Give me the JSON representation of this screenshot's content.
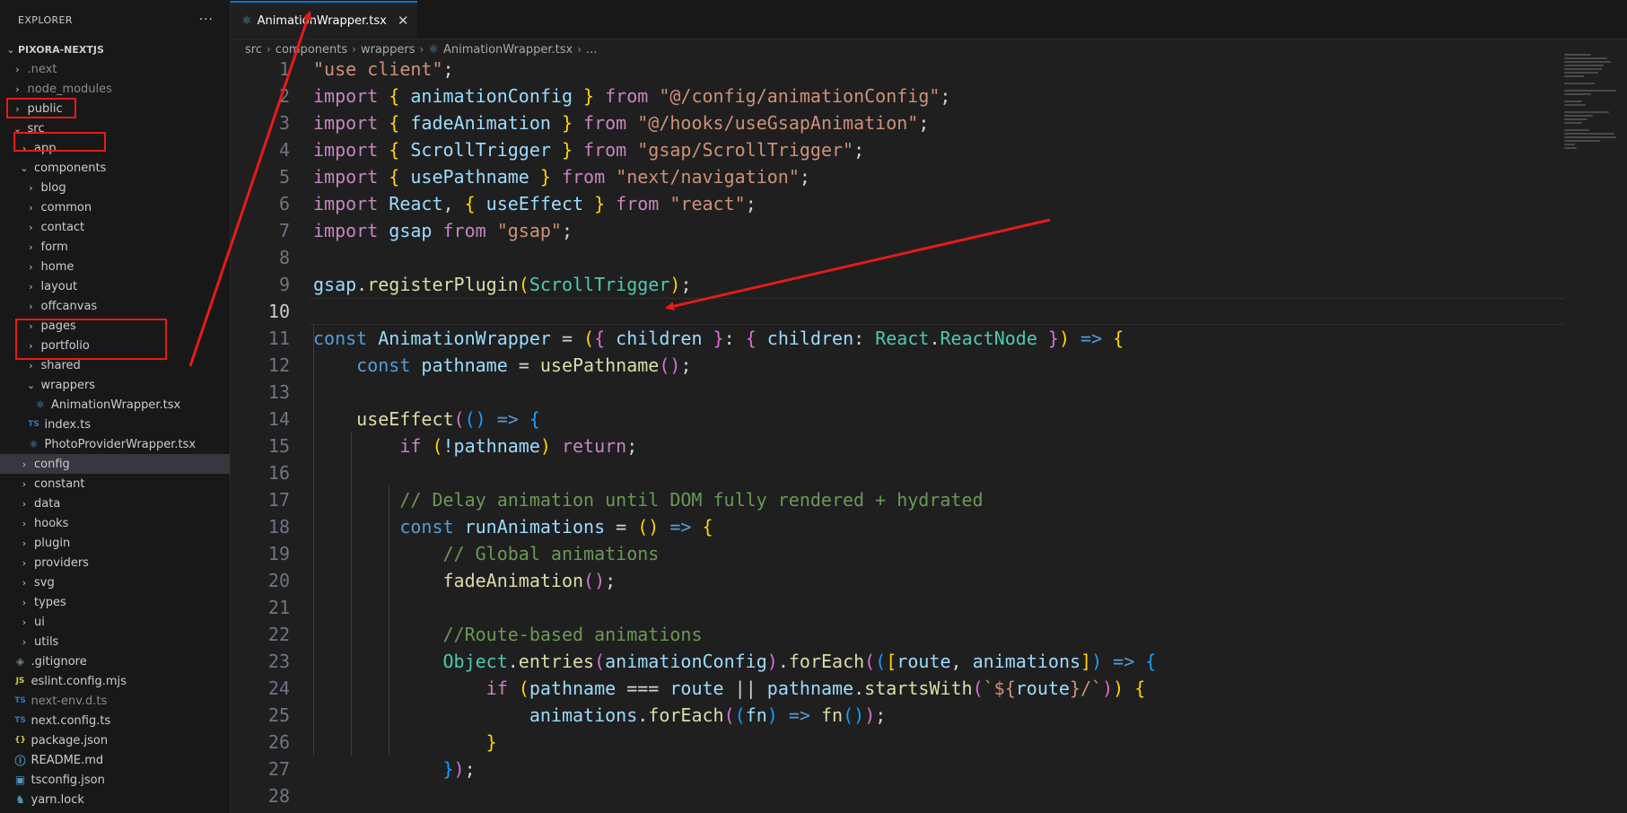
{
  "explorer": {
    "title": "EXPLORER",
    "more": "···",
    "root": "PIXORA-NEXTJS",
    "items": [
      {
        "label": ".next",
        "depth": 1,
        "kind": "folder",
        "open": false,
        "dim": true
      },
      {
        "label": "node_modules",
        "depth": 1,
        "kind": "folder",
        "open": false,
        "dim": true
      },
      {
        "label": "public",
        "depth": 1,
        "kind": "folder",
        "open": false
      },
      {
        "label": "src",
        "depth": 1,
        "kind": "folder",
        "open": true
      },
      {
        "label": "app",
        "depth": 2,
        "kind": "folder",
        "open": false
      },
      {
        "label": "components",
        "depth": 2,
        "kind": "folder",
        "open": true
      },
      {
        "label": "blog",
        "depth": 3,
        "kind": "folder",
        "open": false
      },
      {
        "label": "common",
        "depth": 3,
        "kind": "folder",
        "open": false
      },
      {
        "label": "contact",
        "depth": 3,
        "kind": "folder",
        "open": false
      },
      {
        "label": "form",
        "depth": 3,
        "kind": "folder",
        "open": false
      },
      {
        "label": "home",
        "depth": 3,
        "kind": "folder",
        "open": false
      },
      {
        "label": "layout",
        "depth": 3,
        "kind": "folder",
        "open": false
      },
      {
        "label": "offcanvas",
        "depth": 3,
        "kind": "folder",
        "open": false
      },
      {
        "label": "pages",
        "depth": 3,
        "kind": "folder",
        "open": false
      },
      {
        "label": "portfolio",
        "depth": 3,
        "kind": "folder",
        "open": false
      },
      {
        "label": "shared",
        "depth": 3,
        "kind": "folder",
        "open": false
      },
      {
        "label": "wrappers",
        "depth": 3,
        "kind": "folder",
        "open": true
      },
      {
        "label": "AnimationWrapper.tsx",
        "depth": 4,
        "kind": "react-file"
      },
      {
        "label": "index.ts",
        "depth": 3,
        "kind": "ts-file"
      },
      {
        "label": "PhotoProviderWrapper.tsx",
        "depth": 3,
        "kind": "react-file"
      },
      {
        "label": "config",
        "depth": 2,
        "kind": "folder",
        "open": false,
        "selected": true
      },
      {
        "label": "constant",
        "depth": 2,
        "kind": "folder",
        "open": false
      },
      {
        "label": "data",
        "depth": 2,
        "kind": "folder",
        "open": false
      },
      {
        "label": "hooks",
        "depth": 2,
        "kind": "folder",
        "open": false
      },
      {
        "label": "plugin",
        "depth": 2,
        "kind": "folder",
        "open": false
      },
      {
        "label": "providers",
        "depth": 2,
        "kind": "folder",
        "open": false
      },
      {
        "label": "svg",
        "depth": 2,
        "kind": "folder",
        "open": false
      },
      {
        "label": "types",
        "depth": 2,
        "kind": "folder",
        "open": false
      },
      {
        "label": "ui",
        "depth": 2,
        "kind": "folder",
        "open": false
      },
      {
        "label": "utils",
        "depth": 2,
        "kind": "folder",
        "open": false
      },
      {
        "label": ".gitignore",
        "depth": 1,
        "kind": "git-file"
      },
      {
        "label": "eslint.config.mjs",
        "depth": 1,
        "kind": "js-file"
      },
      {
        "label": "next-env.d.ts",
        "depth": 1,
        "kind": "ts-file",
        "dim": true
      },
      {
        "label": "next.config.ts",
        "depth": 1,
        "kind": "ts-file"
      },
      {
        "label": "package.json",
        "depth": 1,
        "kind": "json-file"
      },
      {
        "label": "README.md",
        "depth": 1,
        "kind": "info-file"
      },
      {
        "label": "tsconfig.json",
        "depth": 1,
        "kind": "tsconfig-file"
      },
      {
        "label": "yarn.lock",
        "depth": 1,
        "kind": "yarn-file"
      }
    ]
  },
  "tab": {
    "label": "AnimationWrapper.tsx",
    "close": "✕"
  },
  "breadcrumb": [
    "src",
    "components",
    "wrappers",
    "AnimationWrapper.tsx",
    "..."
  ],
  "code": {
    "current_line": 10,
    "lines": [
      [
        [
          "\"use client\"",
          "str"
        ],
        [
          ";",
          "pl"
        ]
      ],
      [
        [
          "import",
          "kw"
        ],
        [
          " ",
          "pl"
        ],
        [
          "{",
          "b1"
        ],
        [
          " animationConfig ",
          "var"
        ],
        [
          "}",
          "b1"
        ],
        [
          " from ",
          "kw"
        ],
        [
          "\"@/config/animationConfig\"",
          "str"
        ],
        [
          ";",
          "pl"
        ]
      ],
      [
        [
          "import",
          "kw"
        ],
        [
          " ",
          "pl"
        ],
        [
          "{",
          "b1"
        ],
        [
          " fadeAnimation ",
          "var"
        ],
        [
          "}",
          "b1"
        ],
        [
          " from ",
          "kw"
        ],
        [
          "\"@/hooks/useGsapAnimation\"",
          "str"
        ],
        [
          ";",
          "pl"
        ]
      ],
      [
        [
          "import",
          "kw"
        ],
        [
          " ",
          "pl"
        ],
        [
          "{",
          "b1"
        ],
        [
          " ScrollTrigger ",
          "var"
        ],
        [
          "}",
          "b1"
        ],
        [
          " from ",
          "kw"
        ],
        [
          "\"gsap/ScrollTrigger\"",
          "str"
        ],
        [
          ";",
          "pl"
        ]
      ],
      [
        [
          "import",
          "kw"
        ],
        [
          " ",
          "pl"
        ],
        [
          "{",
          "b1"
        ],
        [
          " usePathname ",
          "var"
        ],
        [
          "}",
          "b1"
        ],
        [
          " from ",
          "kw"
        ],
        [
          "\"next/navigation\"",
          "str"
        ],
        [
          ";",
          "pl"
        ]
      ],
      [
        [
          "import",
          "kw"
        ],
        [
          " React",
          "var"
        ],
        [
          ", ",
          "pl"
        ],
        [
          "{",
          "b1"
        ],
        [
          " useEffect ",
          "var"
        ],
        [
          "}",
          "b1"
        ],
        [
          " from ",
          "kw"
        ],
        [
          "\"react\"",
          "str"
        ],
        [
          ";",
          "pl"
        ]
      ],
      [
        [
          "import",
          "kw"
        ],
        [
          " gsap ",
          "var"
        ],
        [
          "from ",
          "kw"
        ],
        [
          "\"gsap\"",
          "str"
        ],
        [
          ";",
          "pl"
        ]
      ],
      [],
      [
        [
          "gsap",
          "var"
        ],
        [
          ".",
          "pl"
        ],
        [
          "registerPlugin",
          "fn"
        ],
        [
          "(",
          "b1"
        ],
        [
          "ScrollTrigger",
          "ty"
        ],
        [
          ")",
          "b1"
        ],
        [
          ";",
          "pl"
        ]
      ],
      [],
      [
        [
          "const",
          "st"
        ],
        [
          " AnimationWrapper",
          "var"
        ],
        [
          " = ",
          "pl"
        ],
        [
          "(",
          "b1"
        ],
        [
          "{",
          "b2"
        ],
        [
          " children ",
          "var"
        ],
        [
          "}",
          "b2"
        ],
        [
          ": ",
          "pl"
        ],
        [
          "{",
          "b2"
        ],
        [
          " children",
          "var"
        ],
        [
          ": ",
          "pl"
        ],
        [
          "React",
          "ty"
        ],
        [
          ".",
          "pl"
        ],
        [
          "ReactNode",
          "ty"
        ],
        [
          " ",
          "pl"
        ],
        [
          "}",
          "b2"
        ],
        [
          ")",
          "b1"
        ],
        [
          " => ",
          "st"
        ],
        [
          "{",
          "b1"
        ]
      ],
      [
        [
          "    ",
          "pl"
        ],
        [
          "const",
          "st"
        ],
        [
          " pathname",
          "var"
        ],
        [
          " = ",
          "pl"
        ],
        [
          "usePathname",
          "fn"
        ],
        [
          "()",
          "b2"
        ],
        [
          ";",
          "pl"
        ]
      ],
      [],
      [
        [
          "    ",
          "pl"
        ],
        [
          "useEffect",
          "fn"
        ],
        [
          "(",
          "b2"
        ],
        [
          "()",
          "b3"
        ],
        [
          " => ",
          "st"
        ],
        [
          "{",
          "b3"
        ]
      ],
      [
        [
          "        ",
          "pl"
        ],
        [
          "if",
          "kw"
        ],
        [
          " ",
          "pl"
        ],
        [
          "(",
          "b1"
        ],
        [
          "!pathname",
          "var"
        ],
        [
          ")",
          "b1"
        ],
        [
          " return",
          "kw"
        ],
        [
          ";",
          "pl"
        ]
      ],
      [],
      [
        [
          "        ",
          "pl"
        ],
        [
          "// Delay animation until DOM fully rendered + hydrated",
          "cm"
        ]
      ],
      [
        [
          "        ",
          "pl"
        ],
        [
          "const",
          "st"
        ],
        [
          " runAnimations",
          "var"
        ],
        [
          " = ",
          "pl"
        ],
        [
          "()",
          "b1"
        ],
        [
          " => ",
          "st"
        ],
        [
          "{",
          "b1"
        ]
      ],
      [
        [
          "            ",
          "pl"
        ],
        [
          "// Global animations",
          "cm"
        ]
      ],
      [
        [
          "            ",
          "pl"
        ],
        [
          "fadeAnimation",
          "fn"
        ],
        [
          "()",
          "b2"
        ],
        [
          ";",
          "pl"
        ]
      ],
      [],
      [
        [
          "            ",
          "pl"
        ],
        [
          "//Route-based animations",
          "cm"
        ]
      ],
      [
        [
          "            ",
          "pl"
        ],
        [
          "Object",
          "ty"
        ],
        [
          ".",
          "pl"
        ],
        [
          "entries",
          "fn"
        ],
        [
          "(",
          "b2"
        ],
        [
          "animationConfig",
          "var"
        ],
        [
          ")",
          "b2"
        ],
        [
          ".",
          "pl"
        ],
        [
          "forEach",
          "fn"
        ],
        [
          "(",
          "b2"
        ],
        [
          "(",
          "b3"
        ],
        [
          "[",
          "b1"
        ],
        [
          "route",
          "var"
        ],
        [
          ", ",
          "pl"
        ],
        [
          "animations",
          "var"
        ],
        [
          "]",
          "b1"
        ],
        [
          ")",
          "b3"
        ],
        [
          " => ",
          "st"
        ],
        [
          "{",
          "b3"
        ]
      ],
      [
        [
          "                ",
          "pl"
        ],
        [
          "if",
          "kw"
        ],
        [
          " ",
          "pl"
        ],
        [
          "(",
          "b1"
        ],
        [
          "pathname",
          "var"
        ],
        [
          " === ",
          "pl"
        ],
        [
          "route",
          "var"
        ],
        [
          " || ",
          "pl"
        ],
        [
          "pathname",
          "var"
        ],
        [
          ".",
          "pl"
        ],
        [
          "startsWith",
          "fn"
        ],
        [
          "(",
          "b2"
        ],
        [
          "`${",
          "str"
        ],
        [
          "route",
          "var"
        ],
        [
          "}/`",
          "str"
        ],
        [
          ")",
          "b2"
        ],
        [
          ")",
          "b1"
        ],
        [
          " ",
          "pl"
        ],
        [
          "{",
          "b1"
        ]
      ],
      [
        [
          "                    ",
          "pl"
        ],
        [
          "animations",
          "var"
        ],
        [
          ".",
          "pl"
        ],
        [
          "forEach",
          "fn"
        ],
        [
          "(",
          "b2"
        ],
        [
          "(",
          "b3"
        ],
        [
          "fn",
          "var"
        ],
        [
          ")",
          "b3"
        ],
        [
          " => ",
          "st"
        ],
        [
          "fn",
          "fn"
        ],
        [
          "()",
          "b3"
        ],
        [
          ")",
          "b2"
        ],
        [
          ";",
          "pl"
        ]
      ],
      [
        [
          "                ",
          "pl"
        ],
        [
          "}",
          "b1"
        ]
      ],
      [
        [
          "            ",
          "pl"
        ],
        [
          "}",
          "b3"
        ],
        [
          ")",
          "b2"
        ],
        [
          ";",
          "pl"
        ]
      ],
      []
    ]
  },
  "colors": {
    "annotation": "#e51b1b",
    "accent": "#0078d4"
  }
}
